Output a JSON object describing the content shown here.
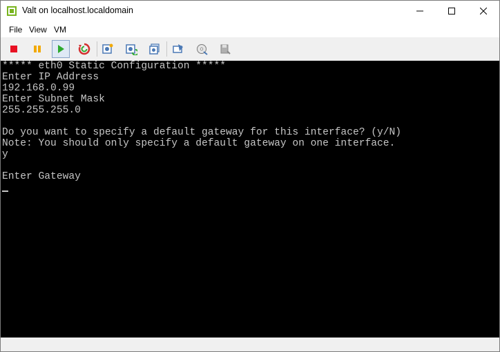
{
  "window": {
    "title": "Valt on localhost.localdomain"
  },
  "menu": {
    "items": [
      {
        "label": "File"
      },
      {
        "label": "View"
      },
      {
        "label": "VM"
      }
    ]
  },
  "toolbar": {
    "buttons": [
      {
        "icon": "stop-icon",
        "color": "#e81123"
      },
      {
        "icon": "pause-icon",
        "color": "#f2a900"
      },
      {
        "icon": "play-icon",
        "color": "#2eaa2e",
        "active": true
      },
      {
        "icon": "reset-icon",
        "color": "#d32f2f"
      },
      {
        "icon": "snapshot-icon"
      },
      {
        "icon": "revert-snapshot-icon"
      },
      {
        "icon": "manage-snapshots-icon"
      },
      {
        "icon": "send-ctrl-alt-del-icon"
      },
      {
        "icon": "connect-cd-icon"
      },
      {
        "icon": "connect-floppy-icon"
      }
    ]
  },
  "console": {
    "lines": [
      "***** eth0 Static Configuration *****",
      "Enter IP Address",
      "192.168.0.99",
      "Enter Subnet Mask",
      "255.255.255.0",
      "",
      "Do you want to specify a default gateway for this interface? (y/N)",
      "Note: You should only specify a default gateway on one interface.",
      "y",
      "",
      "Enter Gateway"
    ]
  }
}
